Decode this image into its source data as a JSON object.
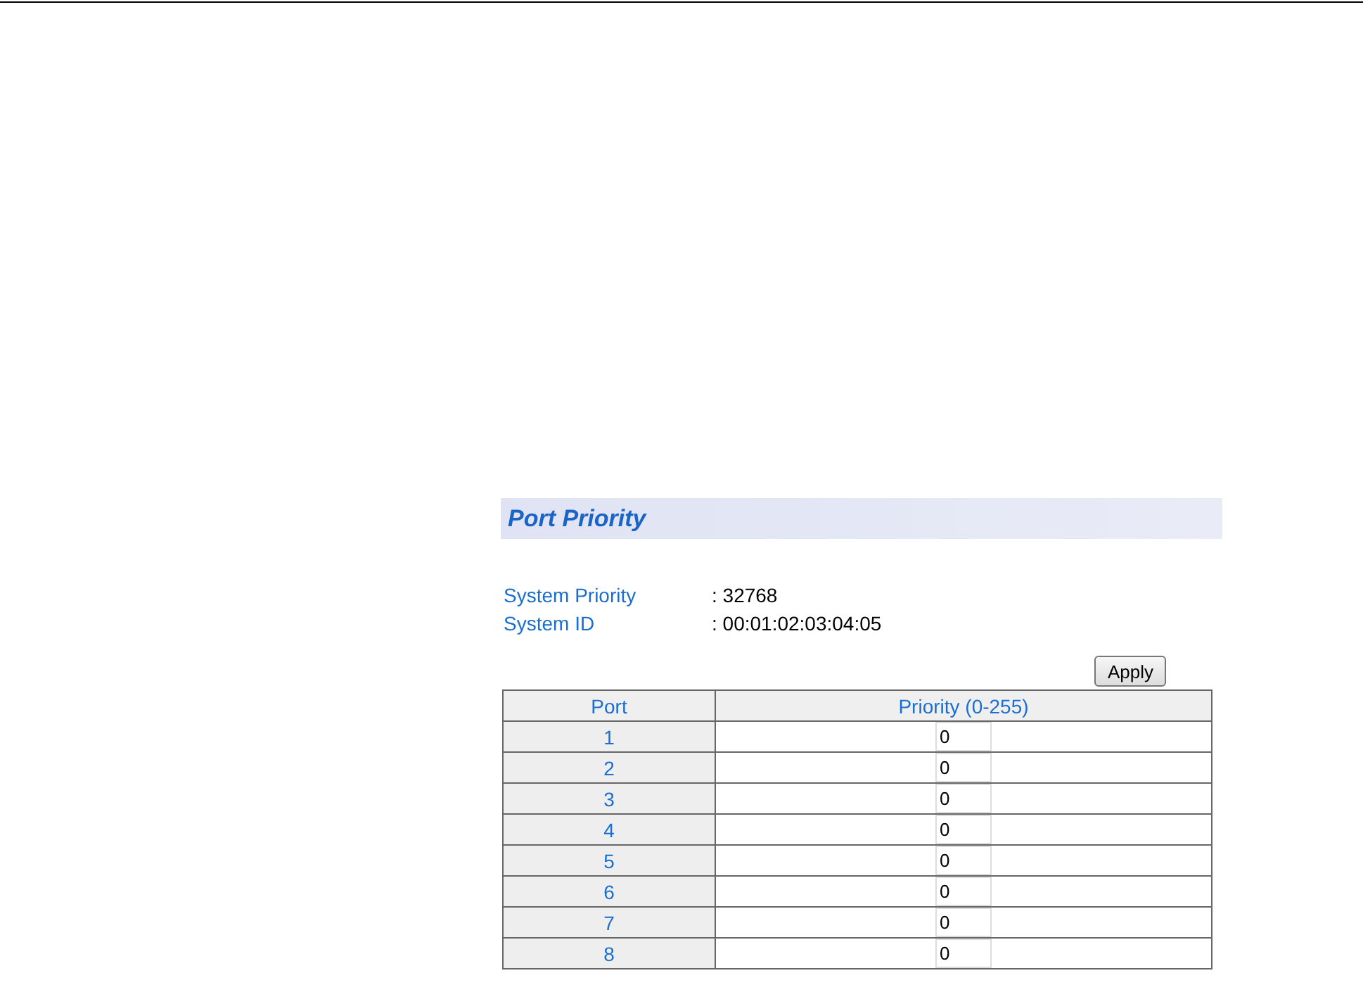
{
  "page": {
    "title": "Port Priority"
  },
  "info": [
    {
      "label": "System Priority",
      "value": ": 32768"
    },
    {
      "label": "System ID",
      "value": ": 00:01:02:03:04:05"
    }
  ],
  "apply_button": "Apply",
  "table": {
    "columns": [
      "Port",
      "Priority (0-255)"
    ],
    "rows": [
      {
        "port": "1",
        "priority": "0"
      },
      {
        "port": "2",
        "priority": "0"
      },
      {
        "port": "3",
        "priority": "0"
      },
      {
        "port": "4",
        "priority": "0"
      },
      {
        "port": "5",
        "priority": "0"
      },
      {
        "port": "6",
        "priority": "0"
      },
      {
        "port": "7",
        "priority": "0"
      },
      {
        "port": "8",
        "priority": "0"
      }
    ]
  }
}
